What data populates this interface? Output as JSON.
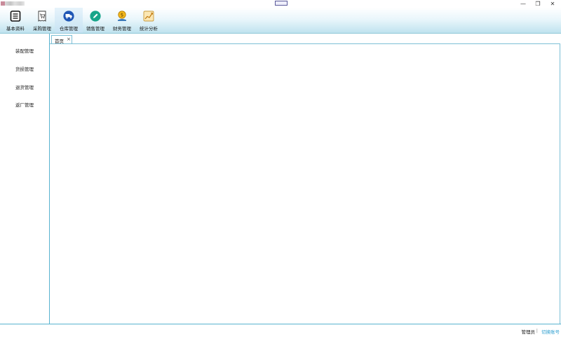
{
  "window": {
    "minimize_glyph": "—",
    "restore_glyph": "❐",
    "close_glyph": "✕"
  },
  "toolbar": {
    "items": [
      {
        "label": "基本资料",
        "icon": "document-list-icon",
        "active": false
      },
      {
        "label": "采购管理",
        "icon": "cart-receipt-icon",
        "active": false
      },
      {
        "label": "仓库管理",
        "icon": "warehouse-truck-icon",
        "active": true
      },
      {
        "label": "销售管理",
        "icon": "pencil-circle-icon",
        "active": false
      },
      {
        "label": "财务管理",
        "icon": "money-hand-icon",
        "active": false
      },
      {
        "label": "统计分析",
        "icon": "chart-trend-icon",
        "active": false
      }
    ]
  },
  "sidebar": {
    "items": [
      {
        "label": "装配管理"
      },
      {
        "label": "货损管理"
      },
      {
        "label": "退货管理"
      },
      {
        "label": "返厂管理"
      }
    ]
  },
  "tabs": [
    {
      "label": "首页",
      "close_glyph": "×"
    }
  ],
  "status": {
    "user_label": "管理员",
    "separator": "|",
    "switch_label": "切换账号"
  },
  "colors": {
    "accent": "#58b3cf",
    "link": "#2f9fd0",
    "active_tool_bg": "#c7e3f3"
  }
}
